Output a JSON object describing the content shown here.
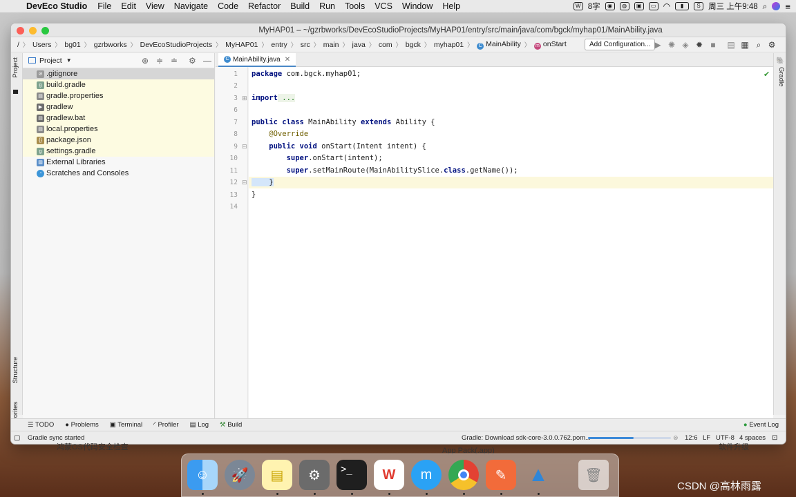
{
  "menubar": {
    "app": "DevEco Studio",
    "items": [
      "File",
      "Edit",
      "View",
      "Navigate",
      "Code",
      "Refactor",
      "Build",
      "Run",
      "Tools",
      "VCS",
      "Window",
      "Help"
    ],
    "input_method": "8字",
    "clock": "周三 上午9:48"
  },
  "window": {
    "title": "MyHAP01 – ~/gzrbworks/DevEcoStudioProjects/MyHAP01/entry/src/main/java/com/bgck/myhap01/MainAbility.java"
  },
  "breadcrumb": [
    "/",
    "Users",
    "bg01",
    "gzrbworks",
    "DevEcoStudioProjects",
    "MyHAP01",
    "entry",
    "src",
    "main",
    "java",
    "com",
    "bgck",
    "myhap01",
    "MainAbility",
    "onStart"
  ],
  "toolbar": {
    "add_config": "Add Configuration..."
  },
  "left_stripe": {
    "project": "Project",
    "structure": "Structure",
    "favorites": "Favorites"
  },
  "right_stripe": {
    "gradle": "Gradle"
  },
  "project_panel": {
    "title": "Project",
    "items": [
      {
        "label": ".gitignore",
        "state": "selected"
      },
      {
        "label": "build.gradle",
        "state": "highlight"
      },
      {
        "label": "gradle.properties",
        "state": "highlight"
      },
      {
        "label": "gradlew",
        "state": "highlight"
      },
      {
        "label": "gradlew.bat",
        "state": "highlight"
      },
      {
        "label": "local.properties",
        "state": "highlight"
      },
      {
        "label": "package.json",
        "state": "highlight"
      },
      {
        "label": "settings.gradle",
        "state": "highlight"
      },
      {
        "label": "External Libraries",
        "state": "normal"
      },
      {
        "label": "Scratches and Consoles",
        "state": "normal"
      }
    ]
  },
  "editor": {
    "tab": "MainAbility.java",
    "line_numbers": [
      "1",
      "2",
      "3",
      "6",
      "7",
      "8",
      "9",
      "10",
      "11",
      "12",
      "13",
      "14"
    ],
    "lines": [
      {
        "kw": "package",
        "rest": " com.bgck.myhap01;"
      },
      {
        "kw": "",
        "rest": ""
      },
      {
        "kw": "import",
        "rest": " ..."
      },
      {
        "kw": "",
        "rest": ""
      },
      {
        "kw": "public class",
        "rest": " MainAbility ",
        "kw2": "extends",
        "rest2": " Ability {"
      },
      {
        "kw": "",
        "rest": "    @Override"
      },
      {
        "kw": "    public void",
        "rest": " onStart(Intent intent) {"
      },
      {
        "kw": "        super",
        "rest": ".onStart(intent);"
      },
      {
        "kw": "        super",
        "rest": ".setMainRoute(MainAbilitySlice.",
        "kw2": "class",
        "rest2": ".getName());"
      },
      {
        "kw": "",
        "rest": "    }"
      },
      {
        "kw": "",
        "rest": "}"
      },
      {
        "kw": "",
        "rest": ""
      }
    ]
  },
  "bottom_tools": [
    "TODO",
    "Problems",
    "Terminal",
    "Profiler",
    "Log",
    "Build"
  ],
  "event_log": "Event Log",
  "status": {
    "left": "Gradle sync started",
    "task": "Gradle: Download sdk-core-3.0.0.762.pom...",
    "progress": 0.55,
    "position": "12:6",
    "line_sep": "LF",
    "encoding": "UTF-8",
    "indent": "4 spaces"
  },
  "behind_text": {
    "left": "鸿蒙OS代码安全检查",
    "center": "App Pack(.app)",
    "right": "软件升级"
  },
  "watermark": "CSDN @高林雨露"
}
